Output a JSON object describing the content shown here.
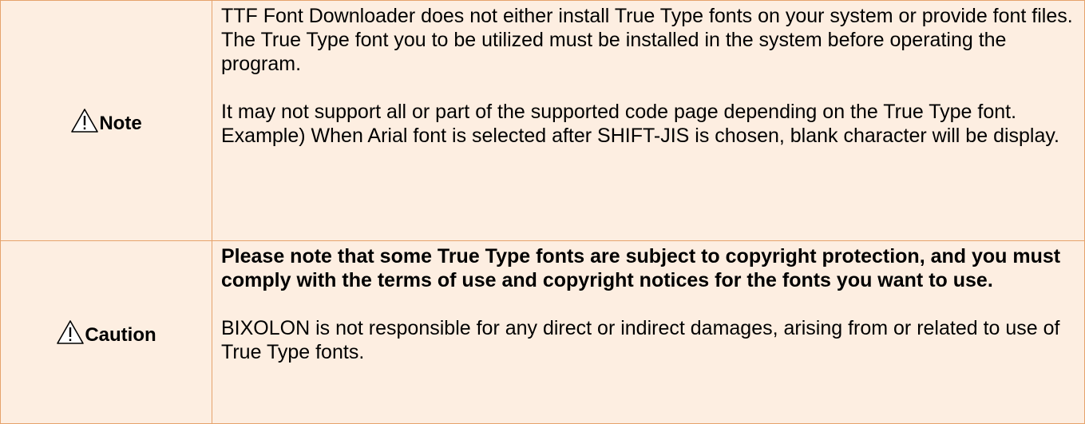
{
  "notices": [
    {
      "label": "Note",
      "icon": "warning-triangle-icon",
      "paragraphs": [
        "TTF Font Downloader does not either install True Type fonts on your system or provide font files. The True Type font you to be utilized must be installed in the system before operating the program."
      ],
      "paragraphs2": [
        "It may not support all or part of the supported code page depending on the True Type font.",
        "Example) When Arial font is selected after SHIFT-JIS is chosen, blank character will be display."
      ]
    },
    {
      "label": "Caution",
      "icon": "warning-triangle-icon",
      "bold_paragraph": "Please note that some True Type fonts are subject to copyright protection, and you must comply with the terms of use and copyright notices for the fonts you want to use.",
      "paragraph": "BIXOLON is not responsible for any direct or indirect damages, arising from or related to use of True Type fonts."
    }
  ],
  "colors": {
    "cell_background": "#fdeee1",
    "border": "#e6a36c"
  }
}
